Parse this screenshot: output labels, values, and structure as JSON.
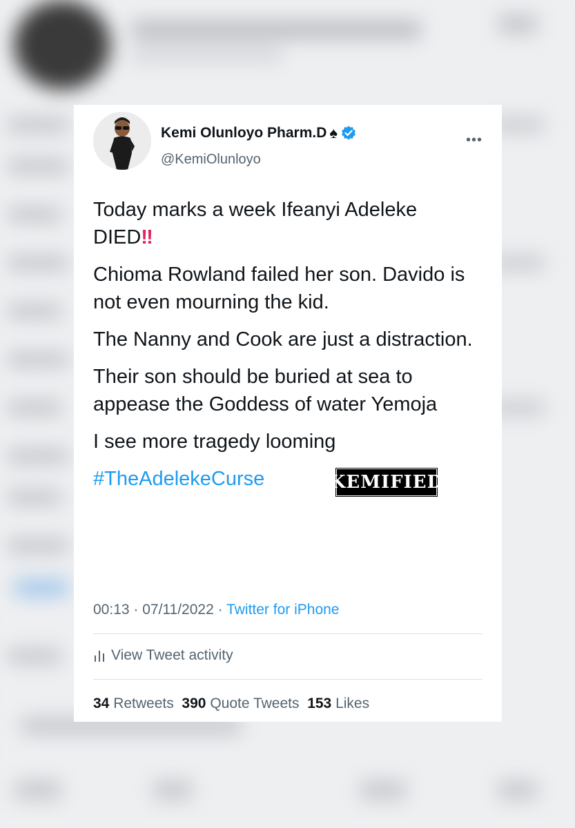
{
  "tweet": {
    "author_name": "Kemi Olunloyo Pharm.D",
    "spade": "♠",
    "handle": "@KemiOlunloyo",
    "more": "•••",
    "lines": {
      "l1a": "Today marks a week Ifeanyi Adeleke",
      "l1b": "DIED",
      "bang": "‼",
      "l2": "Chioma Rowland failed her son. Davido is not even mourning the kid.",
      "l3": "The Nanny and Cook are just a distraction.",
      "l4": "Their son should be buried at sea to appease the Goddess of water Yemoja",
      "l5": "I see more tragedy looming",
      "hashtag": "#TheAdelekeCurse"
    },
    "watermark": "KEMIFIED",
    "time": "00:13",
    "date": "07/11/2022",
    "source": "Twitter for iPhone",
    "activity_label": "View Tweet activity",
    "retweets": "34",
    "retweets_label": "Retweets",
    "quote_tweets": "390",
    "quote_tweets_label": "Quote Tweets",
    "likes": "153",
    "likes_label": "Likes"
  },
  "colors": {
    "link": "#1d9bf0",
    "text": "#0f1419",
    "muted": "#536471"
  }
}
